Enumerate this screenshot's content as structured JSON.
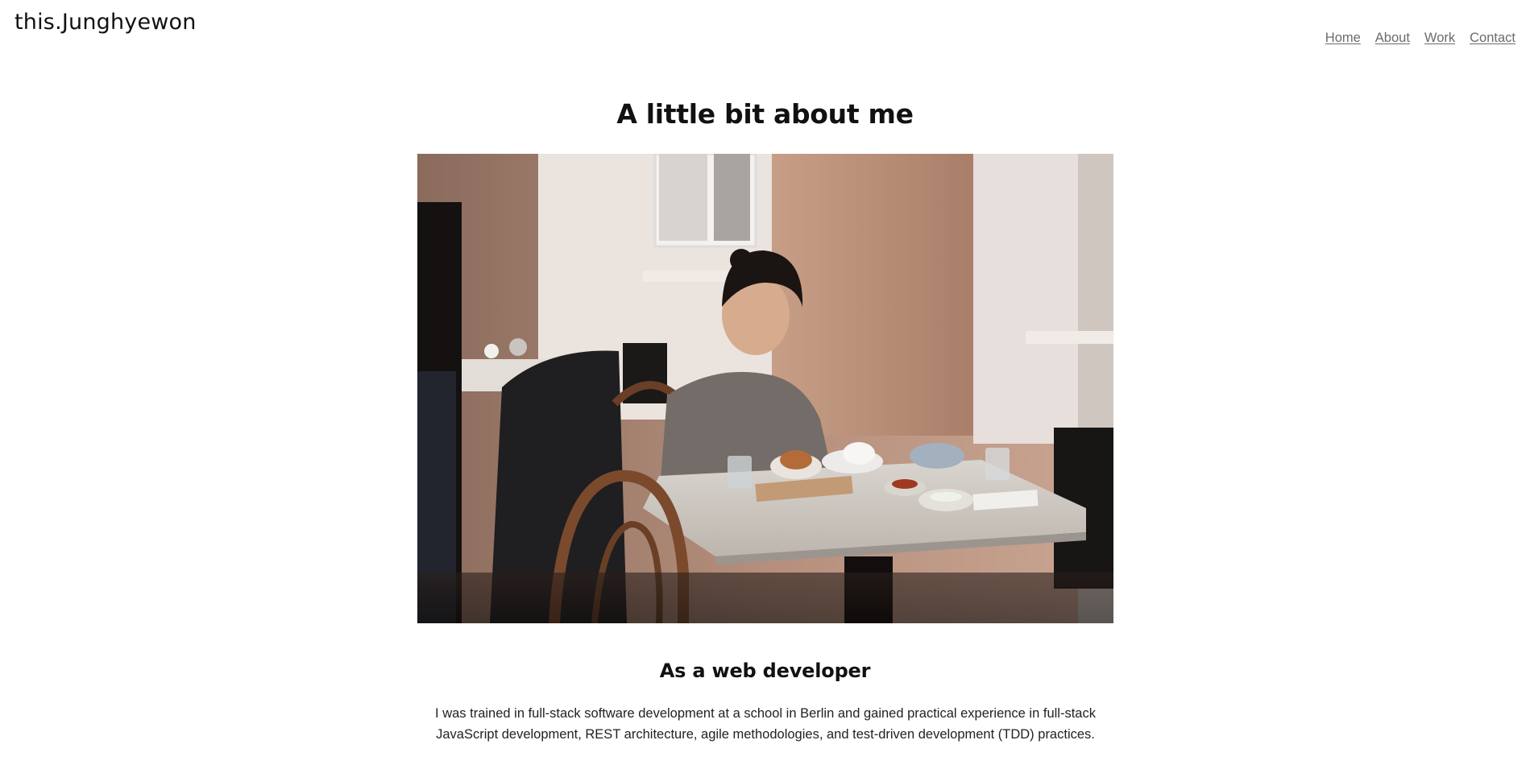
{
  "header": {
    "brand": "this.Junghyewon",
    "nav": [
      {
        "label": "Home"
      },
      {
        "label": "About"
      },
      {
        "label": "Work"
      },
      {
        "label": "Contact"
      }
    ]
  },
  "main": {
    "title": "A little bit about me",
    "photo": {
      "alt": "Woman smiling while eating at a café table by a window"
    },
    "section": {
      "title": "As a web developer",
      "body": "I was trained in full-stack software development at a school in Berlin and gained practical experience in full-stack JavaScript development, REST architecture, agile methodologies, and test-driven development (TDD) practices."
    }
  },
  "colors": {
    "nav_link": "#6b6b6b",
    "text": "#111111",
    "background": "#ffffff"
  }
}
